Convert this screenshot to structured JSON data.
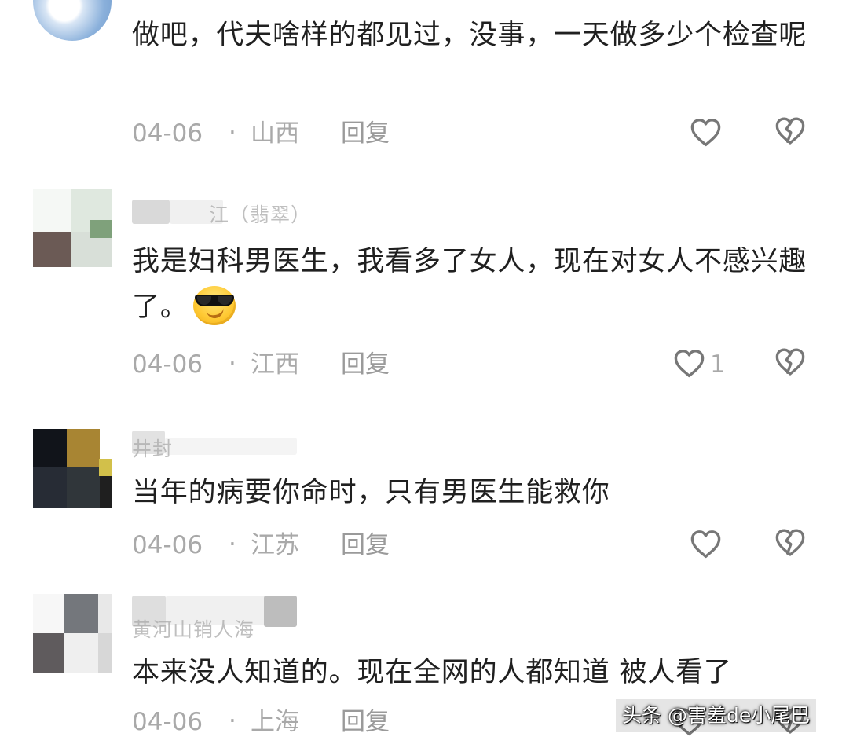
{
  "comments": [
    {
      "text": "做吧，代夫啥样的都见过，没事，一天做多少个检查呢",
      "date": "04-06",
      "separator": "·",
      "location": "山西",
      "reply_label": "回复",
      "like_count": ""
    },
    {
      "username_partial": "江（翡翠）",
      "text": "我是妇科男医生，我看多了女人，现在对女人不感兴趣了。",
      "emoji": "sunglasses-smiley",
      "date": "04-06",
      "separator": "·",
      "location": "江西",
      "reply_label": "回复",
      "like_count": "1"
    },
    {
      "username_partial": "井封",
      "text": "当年的病要你命时，只有男医生能救你",
      "date": "04-06",
      "separator": "·",
      "location": "江苏",
      "reply_label": "回复",
      "like_count": ""
    },
    {
      "username_partial": "黄河山销人海",
      "text": "本来没人知道的。现在全网的人都知道 被人看了",
      "date": "04-06",
      "separator": "·",
      "location": "上海",
      "reply_label": "回复",
      "like_count": ""
    }
  ],
  "icons": {
    "like": "heart-outline-icon",
    "dislike": "broken-heart-icon"
  },
  "colors": {
    "text": "#202020",
    "meta": "#a9a9a9",
    "icon": "#777777",
    "background": "#ffffff"
  },
  "watermark": "头条 @害羞de小尾巴"
}
